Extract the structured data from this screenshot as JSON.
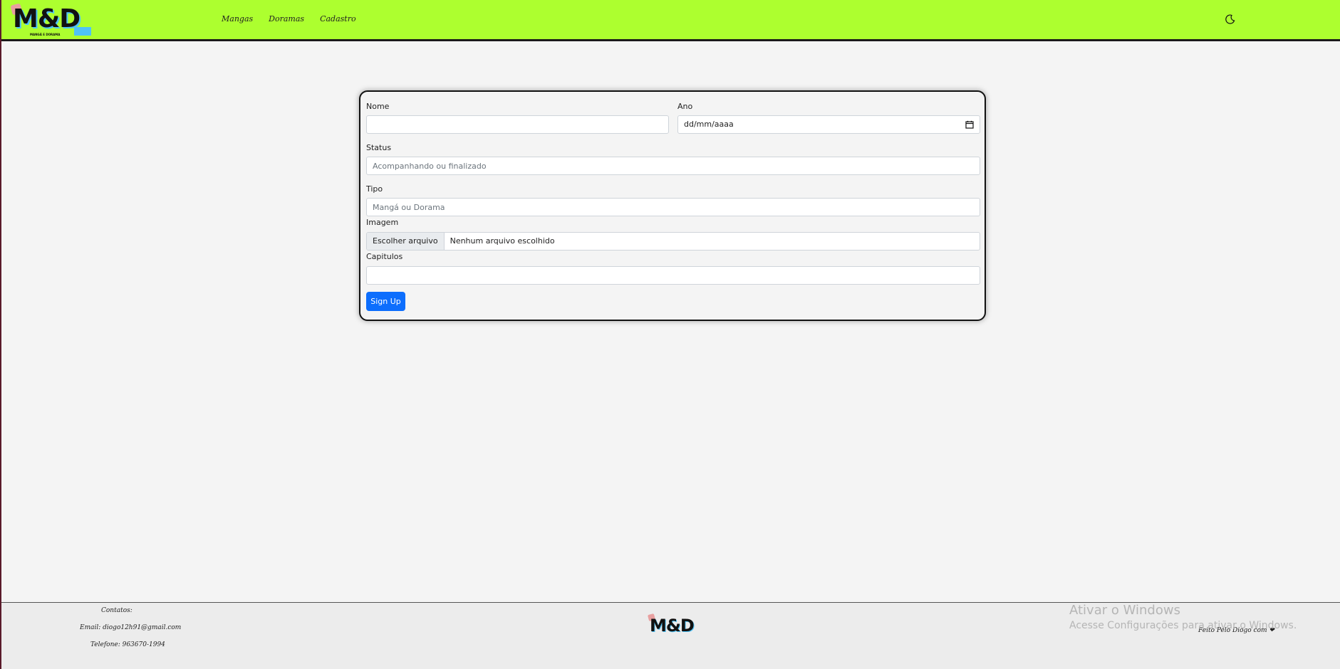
{
  "navbar": {
    "logo_text": "M&D",
    "logo_subtext": "MANGÁ E DORAMA",
    "links": [
      "Mangas",
      "Doramas",
      "Cadastro"
    ],
    "theme_icon": "moon-icon",
    "background": "#adff2f"
  },
  "form": {
    "nome_label": "Nome",
    "nome_value": "",
    "ano_label": "Ano",
    "ano_placeholder": "dd/mm/aaaa",
    "status_label": "Status",
    "status_placeholder": "Acompanhando ou finalizado",
    "tipo_label": "Tipo",
    "tipo_placeholder": "Mangá ou Dorama",
    "imagem_label": "Imagem",
    "file_button": "Escolher arquivo",
    "file_status": "Nenhum arquivo escolhido",
    "capitulos_label": "Capitulos",
    "capitulos_value": "",
    "submit_label": "Sign Up",
    "submit_color": "#0d6efd"
  },
  "footer": {
    "contacts_title": "Contatos:",
    "email": "Email: diogo12h91@gmail.com",
    "phone": "Telefone: 963670-1994",
    "logo_text": "M&D",
    "credit": "Feito Pelo Diogo com ❤"
  },
  "watermark": {
    "title": "Ativar o Windows",
    "subtitle": "Acesse Configurações para ativar o Windows."
  }
}
